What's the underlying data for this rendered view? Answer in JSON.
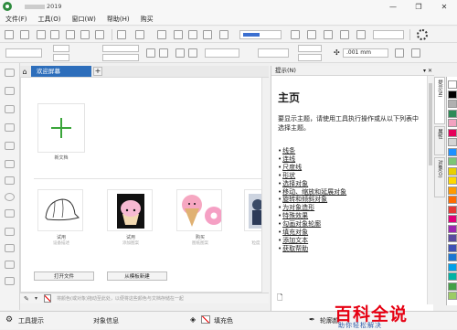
{
  "window": {
    "title_suffix": "2019",
    "controls": {
      "minimize": "—",
      "restore": "❐",
      "close": "✕"
    }
  },
  "menu": [
    {
      "label": "文件(F)"
    },
    {
      "label": "工具(O)"
    },
    {
      "label": "窗口(W)"
    },
    {
      "label": "帮助(H)"
    },
    {
      "label": "购买"
    }
  ],
  "toolbar": {
    "zoom_value": "",
    "nudge_value": ".001 mm"
  },
  "tabs": {
    "home_icon": "house-icon",
    "welcome_label": "欢迎屏幕",
    "add_label": "+"
  },
  "welcome": {
    "new_doc_label": "新文档",
    "templates": [
      {
        "title": "试用",
        "subtitle": "设备描述"
      },
      {
        "title": "试用",
        "subtitle": "添加图案"
      },
      {
        "title": "购买",
        "subtitle": "图纸图案"
      },
      {
        "title": "",
        "subtitle": "粒度"
      }
    ],
    "open_button": "打开文件",
    "template_button": "从模板新建"
  },
  "docbar": {
    "hint_text": "将颜色(或对象)拖动至此处，以便将这些颜色与文档存储在一起"
  },
  "hints": {
    "header": "提示(N)",
    "header_controls": "▾ ✕",
    "title": "主页",
    "intro": "要显示主题，请使用工具执行操作或从以下列表中选择主题。",
    "topics": [
      "线条",
      "连线",
      "尺度线",
      "形状",
      "选择对象",
      "移动、缩放和延展对象",
      "旋转和倾斜对象",
      "为对象造形",
      "特殊效果",
      "勾画对象轮廓",
      "填充对象",
      "添加文本",
      "获取帮助"
    ]
  },
  "dock_tabs": [
    "提示(N)",
    "属性",
    "对象(O)"
  ],
  "palette": [
    "#ffffff",
    "#000000",
    "#b0b0b0",
    "#2e8b57",
    "#f2a2c0",
    "#e5005a",
    "#d4d4d4",
    "#1e90ff",
    "#7cc576",
    "#e8cf00",
    "#ffd800",
    "#ff9a00",
    "#ff6b00",
    "#e53935",
    "#e00078",
    "#9c27b0",
    "#5a4aa0",
    "#3f51b5",
    "#1976d2",
    "#00a0e9",
    "#00b3a4",
    "#43a047",
    "#9ccc65"
  ],
  "statusbar": {
    "tool_hints": "工具提示",
    "object_info": "对象信息",
    "fill": "填充色",
    "outline": "轮廓颜"
  },
  "watermark": {
    "main": "百科全说",
    "sub": "助你轻松解决"
  }
}
